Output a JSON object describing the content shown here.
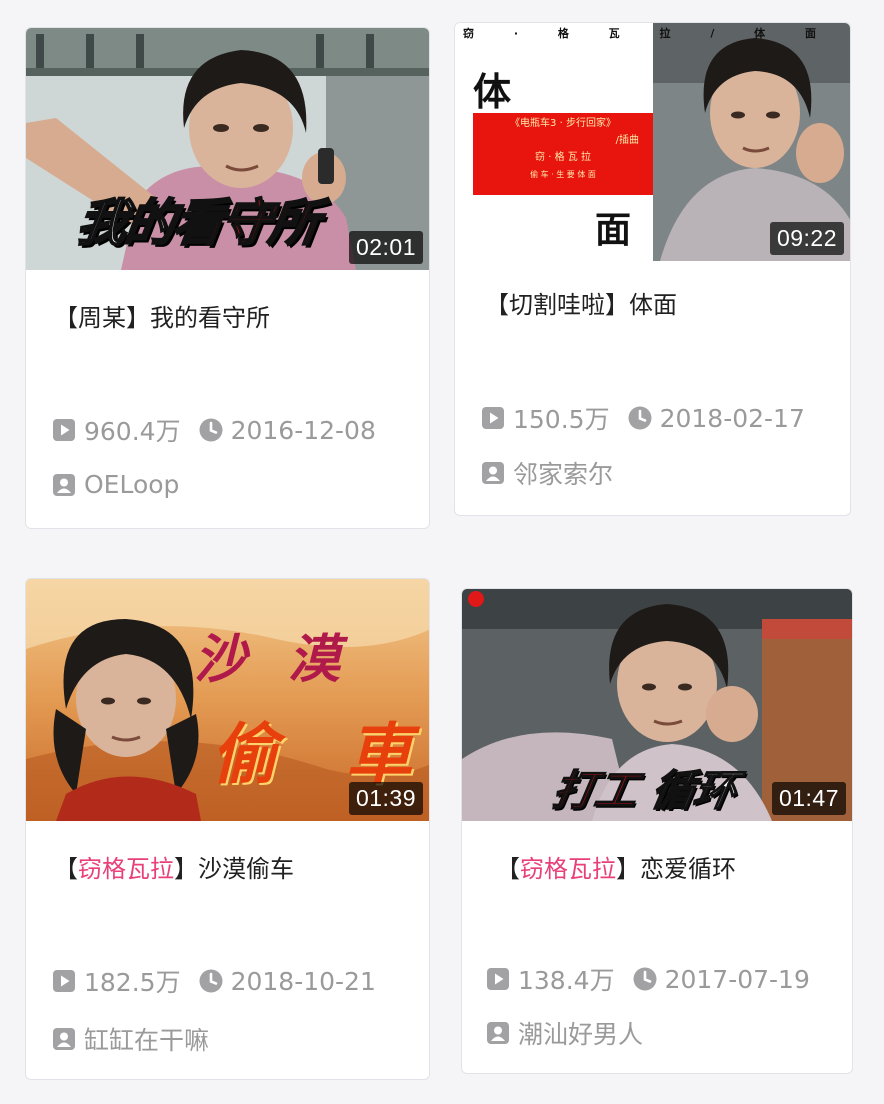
{
  "videos": [
    {
      "duration": "02:01",
      "thumb_text": [
        "我的",
        "看守所"
      ],
      "title_prefix": "【周某】",
      "title_name": "我的看守所",
      "plays": "960.4万",
      "date": "2016-12-08",
      "uploader": "OELoop",
      "icons": [
        "play-count-icon",
        "clock-icon",
        "uploader-icon"
      ]
    },
    {
      "duration": "09:22",
      "thumb_text": {
        "top_strip": "窃 · 格 瓦 拉 / 体 面",
        "big_char_1": "体",
        "big_char_2": "面",
        "red_box_lines": [
          "《电瓶车3 · 步行回家》",
          "/插曲",
          "窃 · 格 瓦 拉",
          "偷 车 · 生 要 体 面"
        ]
      },
      "title_prefix": "【切割哇啦】",
      "title_name": "体面",
      "plays": "150.5万",
      "date": "2018-02-17",
      "uploader": "邻家索尔",
      "icons": [
        "play-count-icon",
        "clock-icon",
        "uploader-icon"
      ]
    },
    {
      "duration": "01:39",
      "thumb_text": [
        "沙",
        "漠",
        "偷",
        "車"
      ],
      "title_open": "【",
      "title_highlight": "窃格瓦拉",
      "title_close": "】",
      "title_name": "沙漠偷车",
      "plays": "182.5万",
      "date": "2018-10-21",
      "uploader": "缸缸在干嘛",
      "icons": [
        "play-count-icon",
        "clock-icon",
        "uploader-icon"
      ]
    },
    {
      "duration": "01:47",
      "thumb_text": [
        "打工",
        "循环"
      ],
      "title_open": "【",
      "title_highlight": "窃格瓦拉",
      "title_close": "】",
      "title_name": "恋爱循环",
      "plays": "138.4万",
      "date": "2017-07-19",
      "uploader": "潮汕好男人",
      "icons": [
        "play-count-icon",
        "clock-icon",
        "uploader-icon"
      ]
    }
  ],
  "colors": {
    "highlight": "#e8417a",
    "meta_text": "#9a9a9a",
    "card_border": "#e2e3e8",
    "red_box": "#e8140e"
  }
}
